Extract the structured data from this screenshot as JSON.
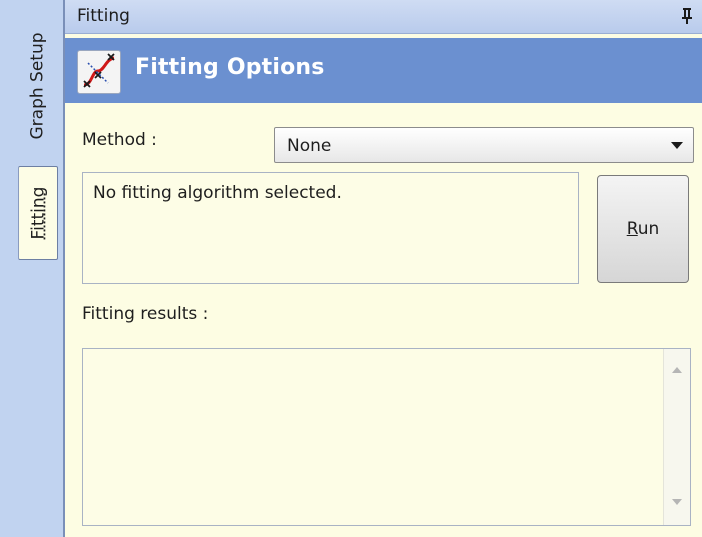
{
  "tabs": {
    "graph_setup": "Graph Setup",
    "fitting": "Fitting"
  },
  "panel": {
    "title": "Fitting",
    "header_title": "Fitting Options"
  },
  "method": {
    "label": "Method :",
    "selected": "None"
  },
  "message": "No fitting algorithm selected.",
  "run_button": "Run",
  "results_label": "Fitting results :",
  "colors": {
    "tab_strip": "#c1d3f0",
    "header_bar": "#6b90d0",
    "panel_background": "#fdfde3"
  },
  "icons": {
    "pin": "pin-icon",
    "fitting_options": "curve-fit-icon"
  }
}
